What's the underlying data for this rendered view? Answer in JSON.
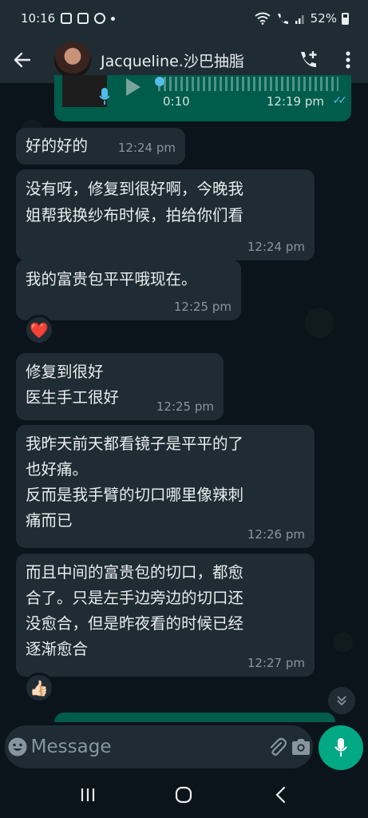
{
  "status_bar": {
    "time": "10:16",
    "battery": "52%",
    "icons": [
      "gallery-icon",
      "calendar-check-icon",
      "b-icon",
      "dot-icon",
      "wifi-icon",
      "vowifi-call-icon",
      "signal-icon",
      "battery-icon"
    ]
  },
  "header": {
    "contact_name": "Jacqueline.沙巴抽脂",
    "icons": [
      "back-arrow-icon",
      "add-call-icon",
      "more-vert-icon"
    ]
  },
  "voice_message": {
    "duration": "0:10",
    "time": "12:19 pm",
    "ticks": "✓✓",
    "direction": "outgoing",
    "status": "read"
  },
  "messages": [
    {
      "text": "好的好的",
      "time": "12:24 pm"
    },
    {
      "lines": [
        "没有呀，修复到很好啊，今晚我",
        "姐帮我换纱布时候，拍给你们看"
      ],
      "time": "12:24 pm"
    },
    {
      "text": "我的富贵包平平哦现在。",
      "time": "12:25 pm",
      "reaction": "❤️"
    },
    {
      "lines": [
        "修复到很好",
        "医生手工很好"
      ],
      "time": "12:25 pm"
    },
    {
      "lines": [
        "我昨天前天都看镜子是平平的了",
        "也好痛。",
        "反而是我手臂的切口哪里像辣刺",
        "痛而已"
      ],
      "time": "12:26 pm"
    },
    {
      "lines": [
        "而且中间的富贵包的切口，都愈",
        "合了。只是左手边旁边的切口还",
        "没愈合，但是昨夜看的时候已经",
        "逐渐愈合"
      ],
      "time": "12:27 pm",
      "reaction": "👍🏻"
    }
  ],
  "composer": {
    "placeholder": "Message",
    "icons": [
      "emoji-icon",
      "attach-icon",
      "camera-icon",
      "mic-icon"
    ]
  },
  "nav_bar": {
    "icons": [
      "recents-icon",
      "home-icon",
      "back-icon"
    ]
  },
  "colors": {
    "background": "#0b141a",
    "incoming_bubble": "#202c33",
    "outgoing_bubble": "#005c4b",
    "accent": "#00a884",
    "read_ticks": "#53bdeb",
    "secondary_text": "#8696a0"
  }
}
